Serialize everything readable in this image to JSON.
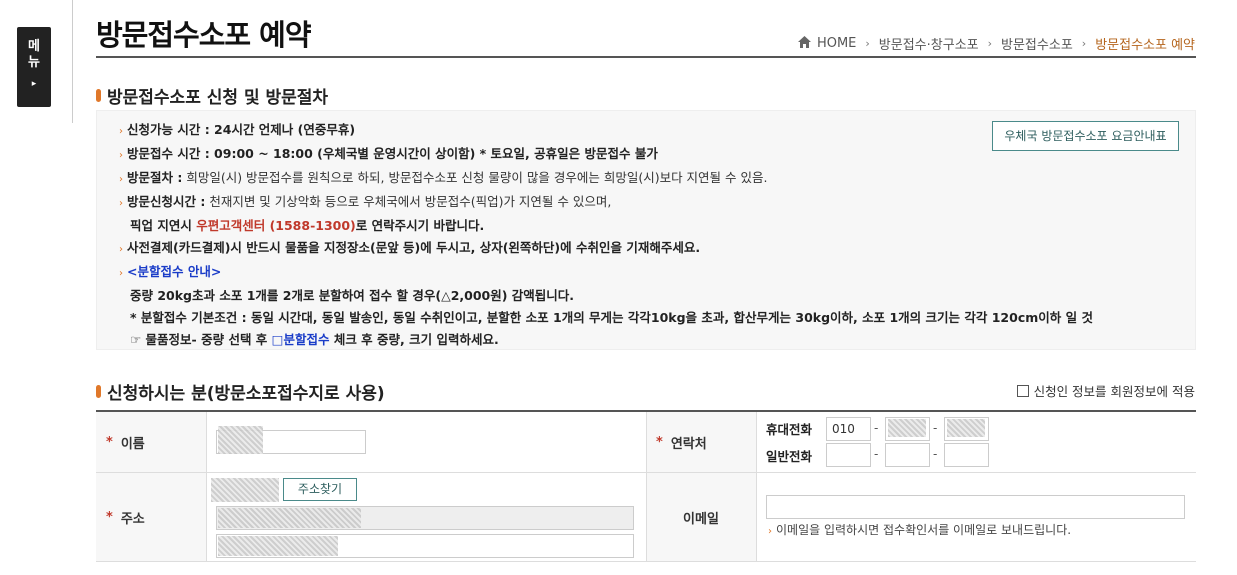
{
  "side_menu": {
    "label_line1": "메",
    "label_line2": "뉴",
    "arrow": "▸"
  },
  "page": {
    "title": "방문접수소포 예약"
  },
  "breadcrumb": {
    "home": "HOME",
    "items": [
      "방문접수·창구소포",
      "방문접수소포",
      "방문접수소포 예약"
    ],
    "separator": "›"
  },
  "section1": {
    "title": "방문접수소포 신청 및 방문절차"
  },
  "info": {
    "fee_button": "우체국 방문접수소포 요금안내표",
    "rows": {
      "r1": "신청가능 시간 : 24시간 언제나 (연중무휴)",
      "r2": "방문접수 시간 : 09:00 ~ 18:00 (우체국별 운영시간이 상이함) * 토요일, 공휴일은 방문접수 불가",
      "r3_label": "방문절차 :",
      "r3_text": " 희망일(시) 방문접수를 원칙으로 하되, 방문접수소포 신청 물량이 많을 경우에는 희망일(시)보다 지연될 수 있음.",
      "r4_label": "방문신청시간 :",
      "r4_text": " 천재지변 및 기상악화 등으로 우체국에서 방문접수(픽업)가 지연될 수 있으며,",
      "r5_pre": "픽업 지연시 ",
      "r5_red": "우편고객센터 (1588-1300)",
      "r5_post": "로 연락주시기 바랍니다.",
      "r6": "사전결제(카드결제)시 반드시 물품을 지정장소(문앞 등)에 두시고, 상자(왼쪽하단)에 수취인을 기재해주세요.",
      "r7": "<분할접수 안내>",
      "r8": "중량 20kg초과 소포 1개를 2개로 분할하여 접수 할 경우(△2,000원) 감액됩니다.",
      "r9": "* 분할접수 기본조건 : 동일 시간대, 동일 발송인, 동일 수취인이고, 분할한 소포 1개의 무게는 각각10kg을 초과, 합산무게는 30kg이하, 소포 1개의 크기는 각각 120cm이하 일 것",
      "r10_pre": "☞ 물품정보- 중량 선택 후 ",
      "r10_blue": "□분할접수",
      "r10_post": " 체크 후 중량, 크기 입력하세요."
    }
  },
  "section2": {
    "title": "신청하시는 분(방문소포접수지로 사용)",
    "apply_member_label": "신청인 정보를 회원정보에 적용"
  },
  "form": {
    "required_mark": "*",
    "name_label": "이름",
    "contact_label": "연락처",
    "mobile_label": "휴대전화",
    "phone_label": "일반전화",
    "mobile_prefix": "010",
    "dash": "-",
    "address_label": "주소",
    "address_button": "주소찾기",
    "email_label": "이메일",
    "email_hint": "이메일을 입력하시면 접수확인서를 이메일로 보내드립니다.",
    "hint_bullet": "›"
  }
}
